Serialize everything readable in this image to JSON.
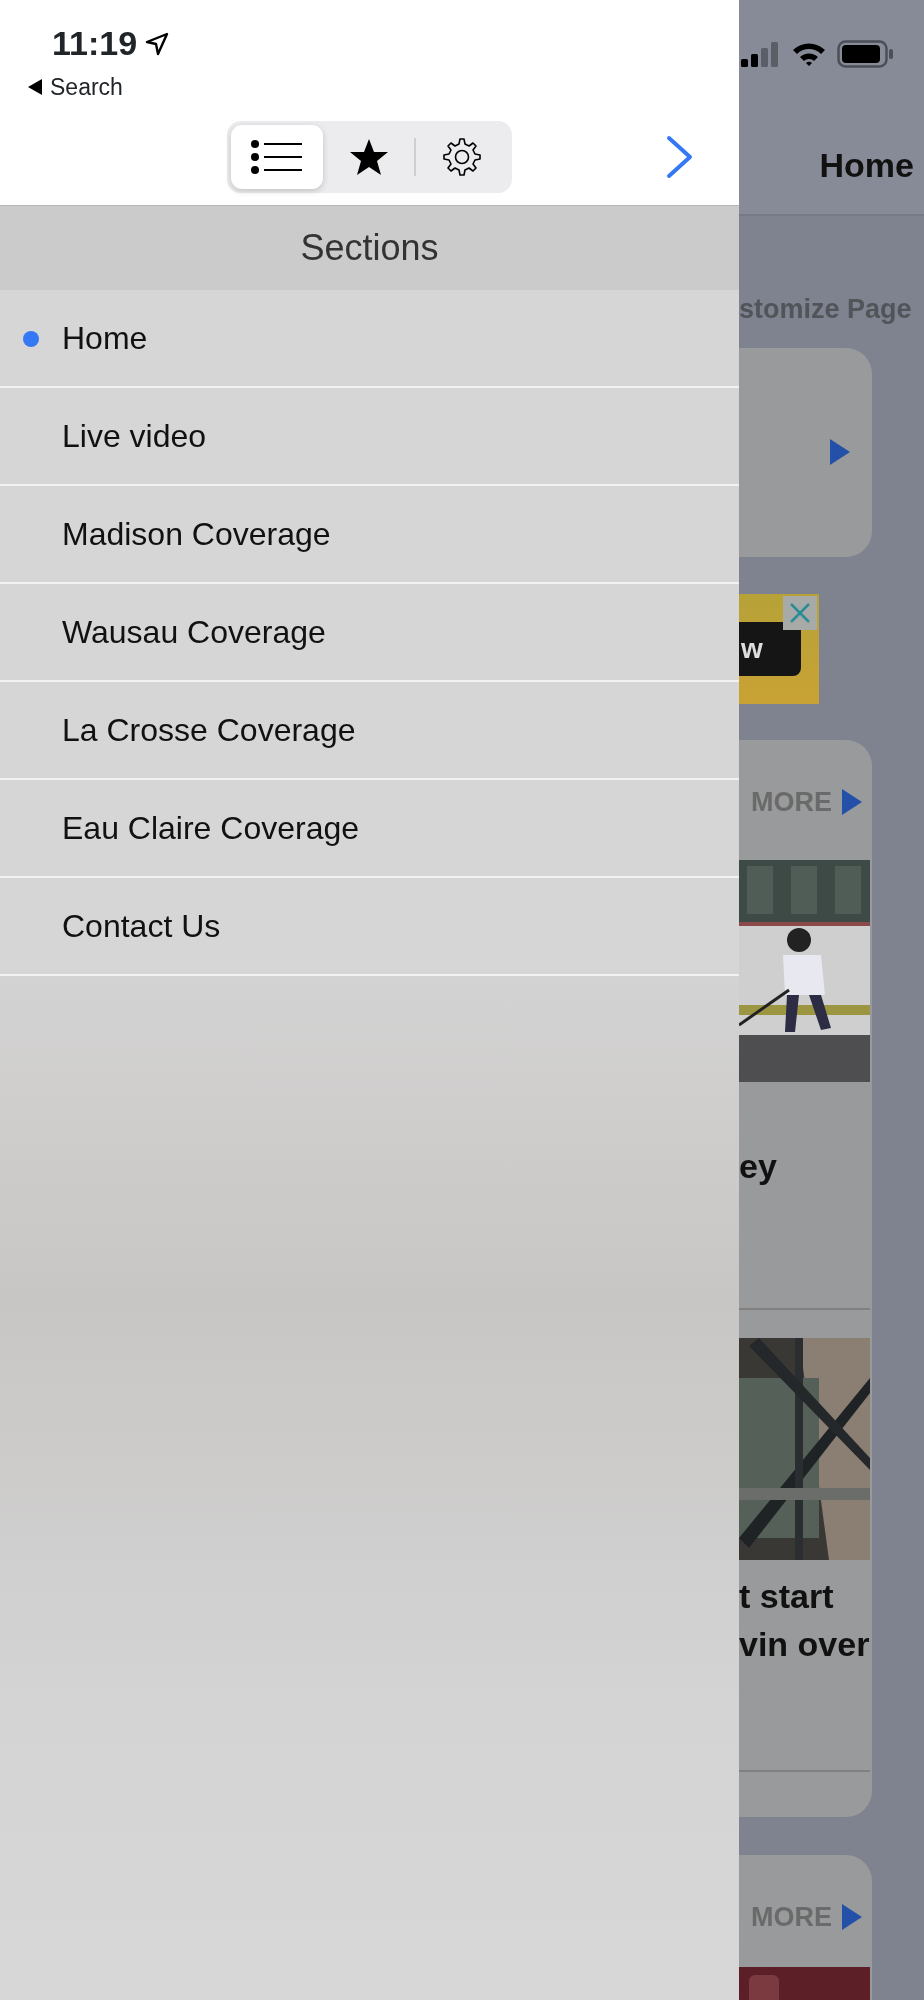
{
  "status_bar": {
    "time": "11:19",
    "back_label": "Search"
  },
  "segmented_control": [
    {
      "kind": "list",
      "selected": true
    },
    {
      "kind": "star",
      "selected": false
    },
    {
      "kind": "gear",
      "selected": false
    }
  ],
  "section_header": "Sections",
  "sections": [
    {
      "label": "Home",
      "selected": true
    },
    {
      "label": "Live video",
      "selected": false
    },
    {
      "label": "Madison Coverage",
      "selected": false
    },
    {
      "label": "Wausau Coverage",
      "selected": false
    },
    {
      "label": "La Crosse Coverage",
      "selected": false
    },
    {
      "label": "Eau Claire Coverage",
      "selected": false
    },
    {
      "label": "Contact Us",
      "selected": false
    }
  ],
  "background_page": {
    "title": "Home",
    "customize_link": "stomize Page",
    "ad_text": "w",
    "story_card": {
      "more": "MORE",
      "stories": [
        {
          "headline_lines": [
            "ey"
          ]
        },
        {
          "headline_lines": [
            "t start",
            "vin over"
          ]
        }
      ]
    },
    "next_card": {
      "more": "MORE"
    }
  }
}
